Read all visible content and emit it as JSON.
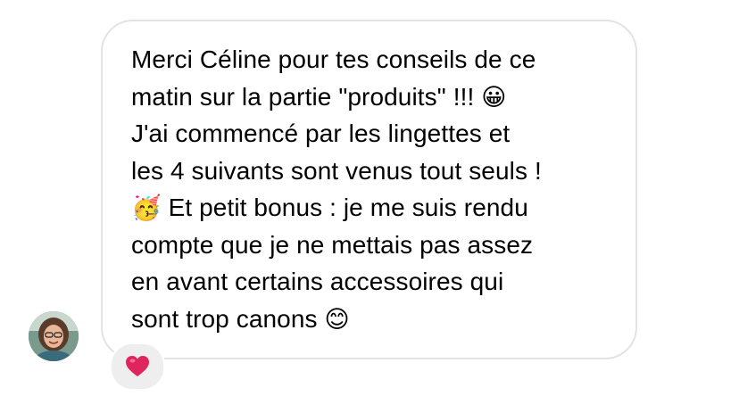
{
  "message": {
    "lines": [
      {
        "text": "Merci Céline pour tes conseils de ce"
      },
      {
        "text": "matin sur la partie \"produits\" !!! ",
        "emoji": "😀"
      },
      {
        "text": "J'ai commencé par les lingettes et"
      },
      {
        "text": "les 4 suivants sont venus tout seuls !"
      },
      {
        "emoji_before": "🥳",
        "text": " Et petit bonus : je me suis rendu"
      },
      {
        "text": "compte que je ne mettais pas assez"
      },
      {
        "text": "en avant certains accessoires qui"
      },
      {
        "text": "sont trop canons ",
        "emoji": "😊"
      }
    ]
  },
  "reaction": {
    "icon": "heart-icon",
    "color": "#e0245e"
  },
  "colors": {
    "bubble_border": "#e3e3e6",
    "reaction_bg": "#eeeeee",
    "text": "#000000"
  }
}
